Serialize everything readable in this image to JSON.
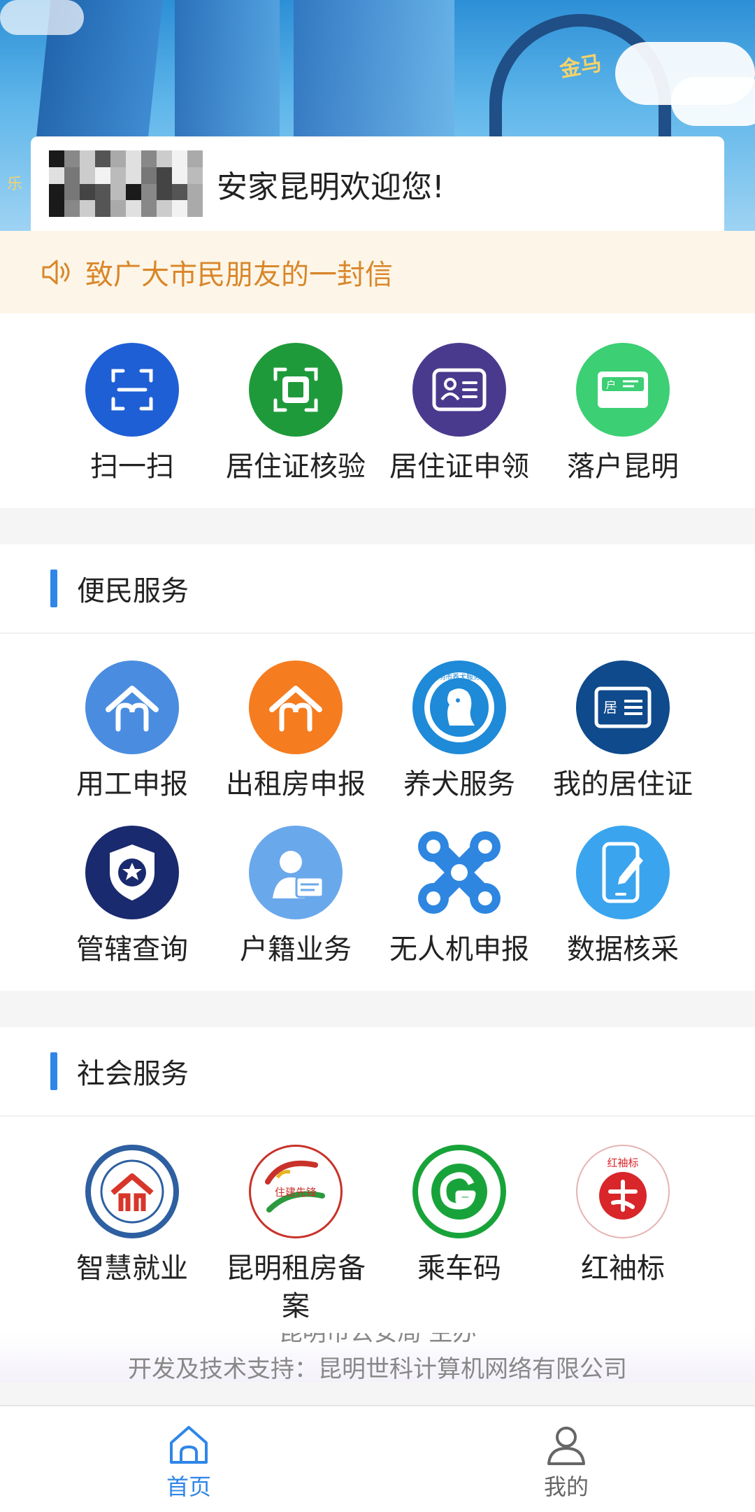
{
  "hero": {
    "sign_text": "金马",
    "side_text": "乐"
  },
  "welcome": {
    "text": "安家昆明欢迎您!"
  },
  "notice": {
    "text": "致广大市民朋友的一封信",
    "icon": "speaker-icon",
    "color": "#d9862a"
  },
  "quick_actions": [
    {
      "label": "扫一扫",
      "icon": "scan-icon",
      "color": "#1f5fd6"
    },
    {
      "label": "居住证核验",
      "icon": "verify-scan-icon",
      "color": "#1f9a3a"
    },
    {
      "label": "居住证申领",
      "icon": "id-card-icon",
      "color": "#4a3a8e"
    },
    {
      "label": "落户昆明",
      "icon": "household-card-icon",
      "color": "#3ccf74"
    }
  ],
  "convenience": {
    "title": "便民服务",
    "items": [
      {
        "label": "用工申报",
        "icon": "house-icon",
        "color": "#4a8de0"
      },
      {
        "label": "出租房申报",
        "icon": "house-icon",
        "color": "#f57c1f"
      },
      {
        "label": "养犬服务",
        "icon": "dog-icon",
        "color": "#1e8ad8",
        "badge": "昆明市养犬服务通"
      },
      {
        "label": "我的居住证",
        "icon": "residence-card-icon",
        "color": "#0e4a8c",
        "badge": "居"
      },
      {
        "label": "管辖查询",
        "icon": "police-badge-icon",
        "color": "#1a2a6e"
      },
      {
        "label": "户籍业务",
        "icon": "person-card-icon",
        "color": "#6aa8ec"
      },
      {
        "label": "无人机申报",
        "icon": "drone-icon",
        "color": "#2e86e0"
      },
      {
        "label": "数据核采",
        "icon": "phone-edit-icon",
        "color": "#3aa4ef"
      }
    ]
  },
  "social": {
    "title": "社会服务",
    "items": [
      {
        "label": "智慧就业",
        "icon": "employment-logo-icon",
        "color": "#2e5fa0"
      },
      {
        "label": "昆明租房备案",
        "icon": "rental-logo-icon",
        "color": "#c8322a",
        "badge": "住建先锋"
      },
      {
        "label": "乘车码",
        "icon": "bus-code-icon",
        "color": "#18a33a"
      },
      {
        "label": "红袖标",
        "icon": "red-armband-icon",
        "color": "#d8262a",
        "badge": "红袖标"
      }
    ]
  },
  "footer": {
    "line1": "昆明市公安局 主办",
    "line2": "开发及技术支持：昆明世科计算机网络有限公司"
  },
  "tabbar": {
    "tabs": [
      {
        "label": "首页",
        "icon": "home-icon",
        "active": true
      },
      {
        "label": "我的",
        "icon": "user-icon",
        "active": false
      }
    ],
    "active_color": "#2f86e8"
  }
}
